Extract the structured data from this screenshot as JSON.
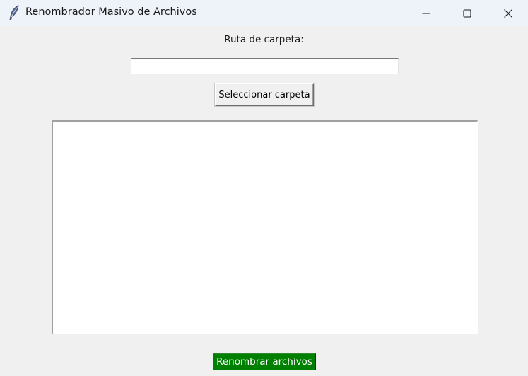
{
  "window": {
    "title": "Renombrador Masivo de Archivos",
    "app_icon": "feather-icon"
  },
  "titlebar_controls": {
    "minimize_icon": "minimize-icon",
    "maximize_icon": "maximize-icon",
    "close_icon": "close-icon"
  },
  "form": {
    "path_label": "Ruta de carpeta:",
    "path_value": "",
    "select_button_label": "Seleccionar carpeta"
  },
  "file_list": {
    "items": []
  },
  "actions": {
    "rename_button_label": "Renombrar archivos",
    "rename_button_color": "#008000"
  },
  "colors": {
    "window_background": "#f0f0f0",
    "titlebar_background": "#eef2f9",
    "list_background": "#ffffff"
  }
}
